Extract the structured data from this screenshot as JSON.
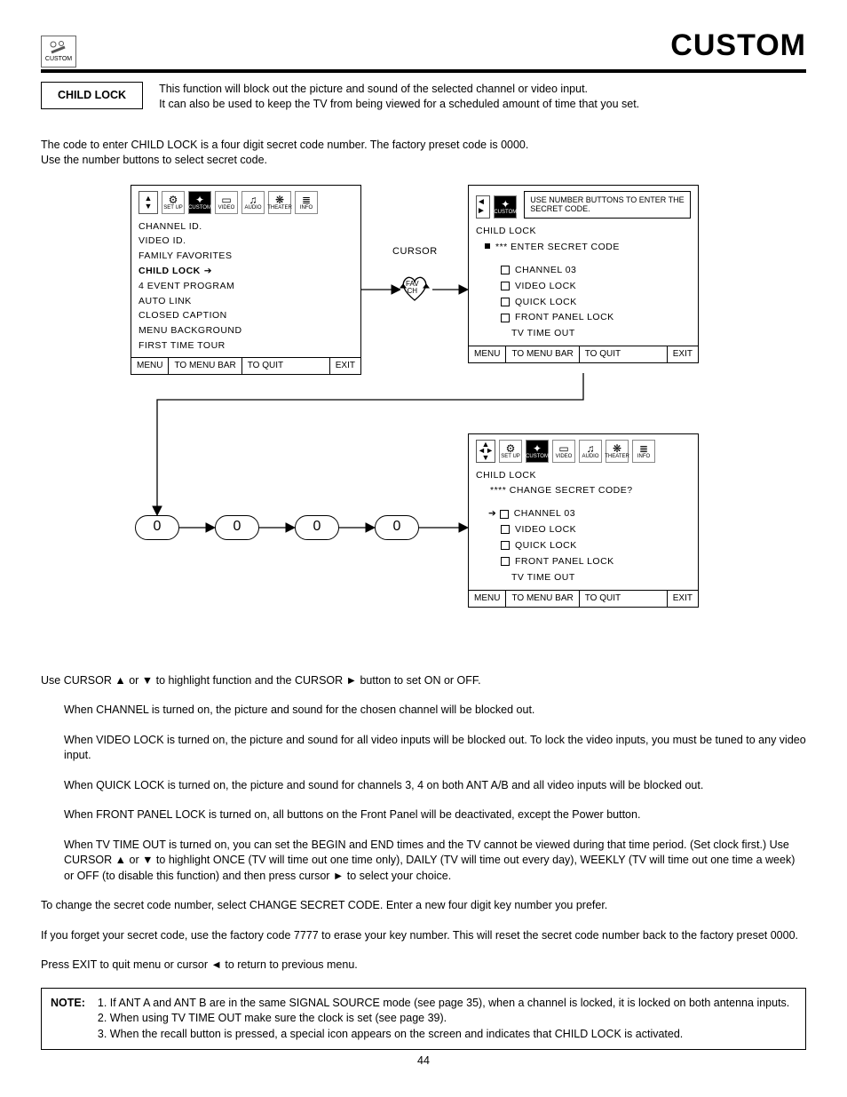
{
  "header": {
    "iconLabel": "CUSTOM",
    "title": "CUSTOM"
  },
  "childLockBox": "CHILD LOCK",
  "intro1": "This function will block out the picture and sound of the selected channel or video input.",
  "intro2": "It can also be used to keep the TV from being viewed for a scheduled amount of time that you set.",
  "para1": "The code to enter CHILD LOCK is a four digit secret code number.  The factory preset code is 0000.",
  "para1b": "Use the number buttons to select secret code.",
  "iconLabels": {
    "setup": "SET UP",
    "custom": "CUSTOM",
    "video": "VIDEO",
    "audio": "AUDIO",
    "theater": "THEATER",
    "info": "INFO"
  },
  "panel1": {
    "items": [
      "CHANNEL ID.",
      "VIDEO ID.",
      "FAMILY FAVORITES",
      "CHILD LOCK",
      "4 EVENT PROGRAM",
      "AUTO LINK",
      "CLOSED CAPTION",
      "MENU BACKGROUND",
      "FIRST TIME TOUR"
    ]
  },
  "footer": {
    "menu": "MENU",
    "toMenuBar": "TO MENU BAR",
    "toQuit": "TO QUIT",
    "exit": "EXIT"
  },
  "cursorLabel": "CURSOR",
  "favCh": "FAV\nCH",
  "panel2": {
    "secretHint": "USE NUMBER BUTTONS TO ENTER THE SECRET CODE.",
    "title": "CHILD LOCK",
    "subtitle": "*** ENTER SECRET CODE",
    "items": [
      "CHANNEL 03",
      "VIDEO LOCK",
      "QUICK LOCK",
      "FRONT PANEL LOCK",
      "TV TIME OUT"
    ]
  },
  "code": [
    "0",
    "0",
    "0",
    "0"
  ],
  "panel3": {
    "title": "CHILD LOCK",
    "subtitle": "**** CHANGE SECRET CODE?",
    "items": [
      "CHANNEL 03",
      "VIDEO LOCK",
      "QUICK LOCK",
      "FRONT PANEL LOCK",
      "TV TIME OUT"
    ]
  },
  "instr": {
    "p1": "Use CURSOR ▲ or ▼ to highlight function and the CURSOR ► button to set ON or OFF.",
    "p2": "When CHANNEL is turned on, the picture and sound for the chosen channel will be blocked out.",
    "p3": "When VIDEO LOCK is turned on, the picture and sound for all video inputs will be blocked out. To lock the video inputs, you must be tuned to any video input.",
    "p4": "When QUICK LOCK is turned on, the picture and sound for channels 3, 4 on both ANT A/B and all video inputs will be blocked out.",
    "p5": "When FRONT PANEL LOCK is turned on, all buttons on the Front Panel will be deactivated, except the Power button.",
    "p6": "When TV TIME OUT is turned on, you can set the BEGIN and END times and the TV cannot be viewed during that time period. (Set clock first.) Use CURSOR ▲ or ▼ to highlight ONCE (TV will time out one time only), DAILY (TV will time out every day), WEEKLY (TV will time out one time a week) or OFF (to disable this function) and then press cursor ► to select your choice.",
    "p7": "To change the secret code number, select CHANGE SECRET CODE.  Enter a new four digit key number you prefer.",
    "p8": "If you forget your secret code, use the factory code 7777 to erase your key number. This will reset the secret code number back to the factory preset 0000.",
    "p9": "Press EXIT to quit menu or cursor ◄ to return to previous menu."
  },
  "note": {
    "label": "NOTE:",
    "n1": "1. If ANT A and ANT B are in the same SIGNAL SOURCE mode (see page 35), when a channel is locked, it is locked on both antenna inputs.",
    "n2": "2. When using TV TIME OUT make sure the clock is set (see page 39).",
    "n3": "3. When the recall button is pressed, a special icon appears on the screen and indicates that CHILD LOCK is activated."
  },
  "pageNum": "44"
}
